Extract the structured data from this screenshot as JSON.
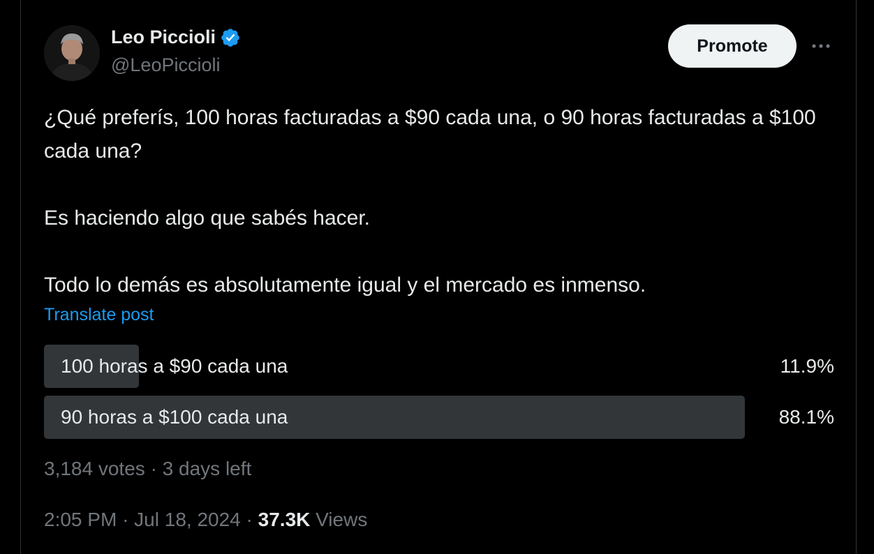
{
  "author": {
    "name": "Leo Piccioli",
    "handle": "@LeoPiccioli",
    "verified_color": "#1d9bf0"
  },
  "header": {
    "promote_label": "Promote",
    "more_icon": "more-horizontal-icon"
  },
  "post": {
    "paragraphs": [
      "¿Qué preferís, 100 horas facturadas a $90 cada una, o 90 horas facturadas a $100 cada una?",
      "Es haciendo algo que sabés hacer.",
      "Todo lo demás es absolutamente igual y el mercado es inmenso."
    ],
    "translate_label": "Translate post"
  },
  "poll": {
    "options": [
      {
        "label": "100 horas a $90 cada una",
        "percent_text": "11.9%",
        "percent": 11.9
      },
      {
        "label": "90 horas a $100 cada una",
        "percent_text": "88.1%",
        "percent": 88.1
      }
    ],
    "votes": "3,184 votes",
    "separator": "·",
    "time_left": "3 days left",
    "bar_color": "#333639"
  },
  "meta": {
    "time": "2:05 PM",
    "separator": "·",
    "date": "Jul 18, 2024",
    "views_count": "37.3K",
    "views_label": "Views"
  }
}
